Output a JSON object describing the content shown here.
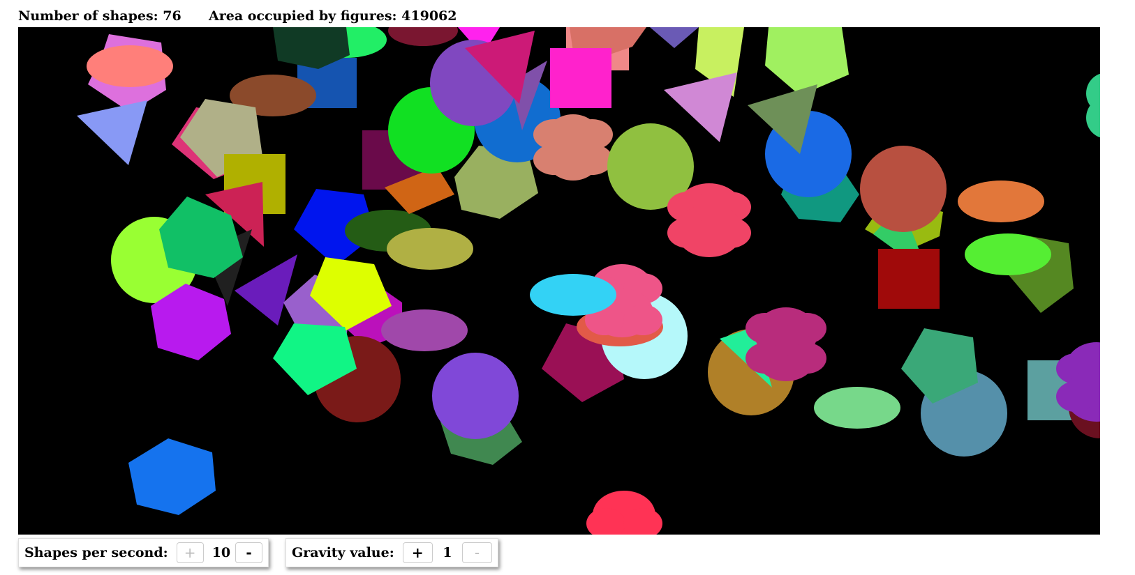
{
  "stats": {
    "shapes_label": "Number of shapes:",
    "shapes_count": "76",
    "area_label": "Area occupied by figures:",
    "area_value": "419062"
  },
  "controls": {
    "shapes_per_second": {
      "label": "Shapes per second:",
      "plus": "+",
      "value": "10",
      "minus": "-",
      "plus_disabled": true,
      "minus_disabled": false
    },
    "gravity": {
      "label": "Gravity value:",
      "plus": "+",
      "value": "1",
      "minus": "-",
      "plus_disabled": false,
      "minus_disabled": true
    }
  },
  "canvas": {
    "background": "#000000"
  }
}
